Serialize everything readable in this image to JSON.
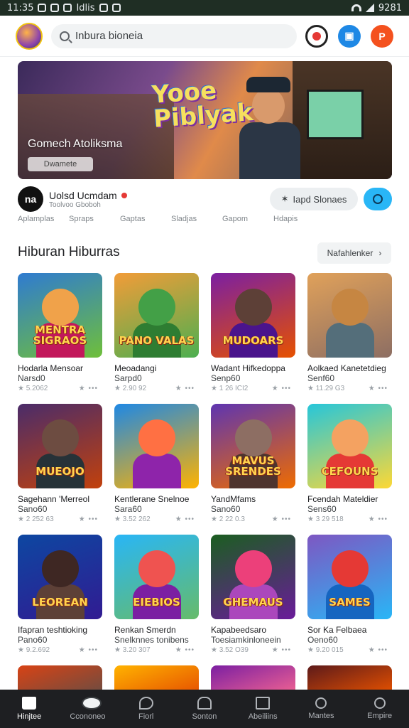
{
  "status_bar": {
    "time": "11:35",
    "extra_left": "Idlis",
    "battery_text": "9281"
  },
  "search": {
    "value": "Inbura bioneia"
  },
  "banner": {
    "title_line1": "Yooe",
    "title_line2": "Piblyak",
    "subtitle": "Gomech Atoliksma",
    "button_label": "Dwamete"
  },
  "developer": {
    "avatar_text": "na",
    "name": "Uolsd  Ucmdam",
    "subtitle": "Toolvoo  Gboboh",
    "pill_label": "Iapd Slonaes"
  },
  "chips": [
    "Aplamplas",
    "Spraps",
    "Gaptas",
    "Sladjas",
    "Gapom",
    "Hdapis"
  ],
  "section": {
    "title": "Hiburan Hiburras",
    "more_label": "Nafahlenker"
  },
  "apps": [
    {
      "thumb_label": "MENTRA SIGRAOS",
      "name": "Hodarla Mensoar",
      "developer": "Narsd0",
      "meta": "★ 5.2062",
      "colors": [
        "#2f7bd1",
        "#6fbf3a"
      ],
      "char": "#f0a24a",
      "body": "#c2185b"
    },
    {
      "thumb_label": "PANO VALAS",
      "name": "Meoadangi",
      "developer": "Sarpd0",
      "meta": "★ 2.90 92",
      "colors": [
        "#f29c38",
        "#4caf50"
      ],
      "char": "#43a047",
      "body": "#2e7d32"
    },
    {
      "thumb_label": "MUDOARS",
      "name": "Wadant Hifkedoppa",
      "developer": "Senp60",
      "meta": "★ 1 26 ICI2",
      "colors": [
        "#7b1fa2",
        "#e65100"
      ],
      "char": "#5d4037",
      "body": "#4a148c"
    },
    {
      "thumb_label": "",
      "name": "Aolkaed Kanetetdieg",
      "developer": "Senf60",
      "meta": "★ 11.29 G3",
      "colors": [
        "#e0a15a",
        "#8d6e63"
      ],
      "char": "#c68642",
      "body": "#546e7a"
    },
    {
      "thumb_label": "MUEOJO",
      "name": "Sagehann 'Merreol",
      "developer": "Sano60",
      "meta": "★ 2 252 63",
      "colors": [
        "#4a2c6a",
        "#c2410c"
      ],
      "char": "#6d4c41",
      "body": "#263238"
    },
    {
      "thumb_label": "",
      "name": "Kentlerane Snelnoe",
      "developer": "Sara60",
      "meta": "★ 3.52 262",
      "colors": [
        "#1e88e5",
        "#ffb300"
      ],
      "char": "#ff7043",
      "body": "#8e24aa"
    },
    {
      "thumb_label": "MAVUS SRENDES",
      "name": "YandMfams",
      "developer": "Sano60",
      "meta": "★ 2 22 0.3",
      "colors": [
        "#5e35b1",
        "#ef6c00"
      ],
      "char": "#8d6e63",
      "body": "#4e342e"
    },
    {
      "thumb_label": "CEFOUNS",
      "name": "Fcendah Mateldier",
      "developer": "Sens60",
      "meta": "★ 3 29 518",
      "colors": [
        "#26c6da",
        "#fdd835"
      ],
      "char": "#f4a261",
      "body": "#e53935"
    },
    {
      "thumb_label": "LEOREAN",
      "name": "Ifapran teshtioking",
      "developer": "Pano60",
      "meta": "★ 9.2.692",
      "colors": [
        "#0d47a1",
        "#311b92"
      ],
      "char": "#3e2723",
      "body": "#5d4037"
    },
    {
      "thumb_label": "EIEBIOS",
      "name": "Renkan Smerdn",
      "developer": "Snelknnes tonibens",
      "meta": "★ 3.20 307",
      "colors": [
        "#29b6f6",
        "#66bb6a"
      ],
      "char": "#ef5350",
      "body": "#7b1fa2"
    },
    {
      "thumb_label": "GHEMAUS",
      "name": "Kapabeedsaro",
      "developer": "Toesiamkinloneein",
      "meta": "★ 3.52 O39",
      "colors": [
        "#1b5e20",
        "#6a1b9a"
      ],
      "char": "#ec407a",
      "body": "#ab47bc"
    },
    {
      "thumb_label": "SAMES",
      "name": "Sor Ka Felbaea",
      "developer": "Oeno60",
      "meta": "★ 9.20 015",
      "colors": [
        "#7e57c2",
        "#29b6f6"
      ],
      "char": "#e53935",
      "body": "#1565c0"
    }
  ],
  "partial_thumbs": [
    {
      "colors": [
        "#d84315",
        "#6d4c41"
      ]
    },
    {
      "colors": [
        "#ffb300",
        "#e65100"
      ]
    },
    {
      "colors": [
        "#7b1fa2",
        "#f06292"
      ]
    },
    {
      "colors": [
        "#5d1a1a",
        "#e65100"
      ]
    }
  ],
  "navbar": [
    {
      "label": "Hinjtee",
      "icon": "home-icon",
      "active": true
    },
    {
      "label": "Ccononeo",
      "icon": "search-icon",
      "active": false
    },
    {
      "label": "Fiorl",
      "icon": "chat-icon",
      "active": false
    },
    {
      "label": "Sonton",
      "icon": "house-icon",
      "active": false
    },
    {
      "label": "Abeiliins",
      "icon": "list-icon",
      "active": false
    },
    {
      "label": "Mantes",
      "icon": "person-icon",
      "active": false
    },
    {
      "label": "Empire",
      "icon": "profile-icon",
      "active": false
    }
  ]
}
